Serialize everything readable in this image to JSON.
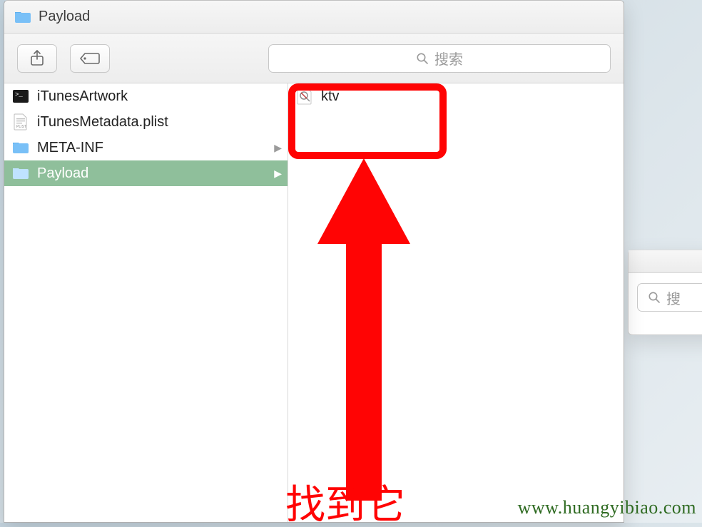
{
  "window": {
    "title": "Payload",
    "search_placeholder": "搜索"
  },
  "left_col": {
    "items": [
      {
        "name": "iTunesArtwork",
        "kind": "terminal",
        "folder": false,
        "selected": false
      },
      {
        "name": "iTunesMetadata.plist",
        "kind": "plist",
        "folder": false,
        "selected": false
      },
      {
        "name": "META-INF",
        "kind": "folder",
        "folder": true,
        "selected": false
      },
      {
        "name": "Payload",
        "kind": "folder",
        "folder": true,
        "selected": true
      }
    ]
  },
  "right_col": {
    "items": [
      {
        "name": "ktv",
        "kind": "app"
      }
    ]
  },
  "back_window": {
    "search_placeholder": "搜"
  },
  "annotation": {
    "label": "找到它"
  },
  "watermark": "www.huangyibiao.com"
}
